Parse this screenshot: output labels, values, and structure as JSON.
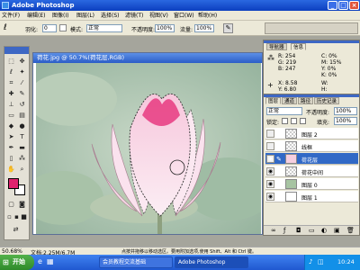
{
  "window": {
    "title": "Adobe Photoshop"
  },
  "menu": [
    "文件(F)",
    "编辑(E)",
    "图像(I)",
    "图层(L)",
    "选择(S)",
    "滤镜(T)",
    "视图(V)",
    "窗口(W)",
    "帮助(H)"
  ],
  "options": {
    "feather_label": "羽化:",
    "feather_value": "0",
    "mode_label": "模式:",
    "mode_value": "正常",
    "opacity_label": "不透明度:",
    "opacity_value": "100%",
    "flow_label": "流量:",
    "flow_value": "100%"
  },
  "document": {
    "title": "荷花.jpg @ 50.7%(荷花层,RGB)"
  },
  "nav_panel": {
    "tabs": [
      "导航器",
      "信息"
    ],
    "r": "R: 254",
    "g": "G: 219",
    "b": "B: 247",
    "c": "C: 0%",
    "m": "M: 15%",
    "y": "Y: 0%",
    "k": "K: 0%",
    "x": "X: 8.58",
    "y2": "Y: 6.80",
    "w": "W:",
    "h": "H:"
  },
  "layers_panel": {
    "tabs": [
      "图层",
      "通道",
      "路径",
      "历史记录"
    ],
    "blend_mode": "正常",
    "opacity_label": "不透明度:",
    "opacity_value": "100%",
    "lock_label": "锁定:",
    "fill_label": "填充:",
    "fill_value": "100%",
    "layers": [
      {
        "name": "图层 2"
      },
      {
        "name": "线框"
      },
      {
        "name": "荷花层"
      },
      {
        "name": "荷花中间"
      },
      {
        "name": "图层 0"
      },
      {
        "name": "图层 1"
      }
    ]
  },
  "status": {
    "zoom": "50.68%",
    "doc_size": "文档:2.25M/6.7M",
    "hint": "点按并拖移以移动选区。要用附加选项,使用 Shift、Alt 和 Ctrl 键。"
  },
  "taskbar": {
    "start": "开始",
    "tasks": [
      "会员教程交流基础",
      "Adobe Photoshop"
    ],
    "time": "10:24"
  },
  "colors": {
    "foreground": "#e0226e",
    "background": "#ffffff",
    "accent": "#3169c6"
  }
}
